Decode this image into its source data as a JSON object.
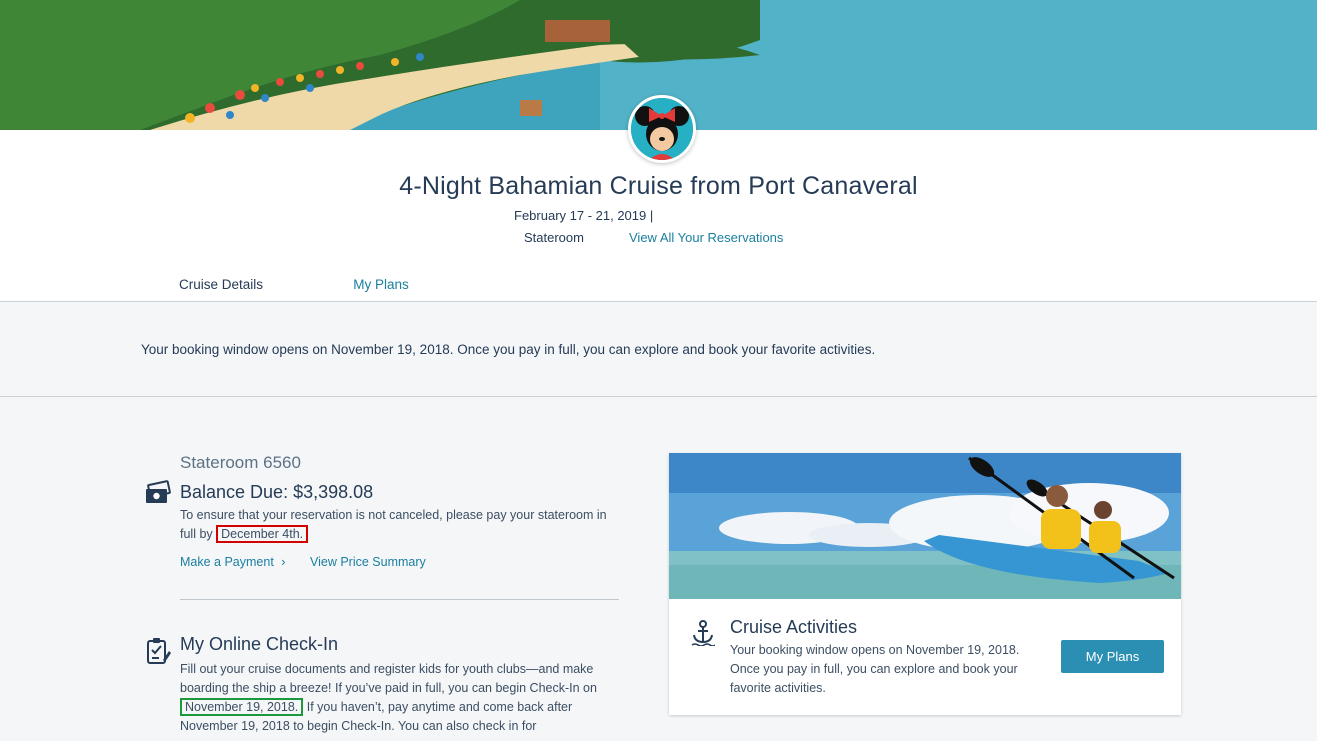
{
  "header": {
    "title": "4-Night Bahamian Cruise from Port Canaveral",
    "dates": "February 17 - 21, 2019 |",
    "stateroom_label": "Stateroom",
    "view_reservations_link": "View All Your Reservations"
  },
  "tabs": [
    {
      "label": "Cruise Details",
      "active": true
    },
    {
      "label": "My Plans",
      "active": false
    }
  ],
  "notice": "Your booking window opens on November 19, 2018. Once you pay in full, you can explore and book your favorite activities.",
  "stateroom_section": {
    "stateroom_number": "Stateroom 6560",
    "balance_due": "Balance Due: $3,398.08",
    "text_line1": "To ensure that your reservation is not canceled, please pay your stateroom in",
    "text_prefix": "full by",
    "due_date": "December 4th.",
    "make_payment_link": "Make a Payment",
    "view_price_link": "View Price Summary"
  },
  "checkin_section": {
    "title": "My Online Check-In",
    "line1": "Fill out your cruise documents and register kids for youth clubs—and make",
    "line2": "boarding the ship a breeze! If you’ve paid in full, you can begin Check-In on",
    "highlight_date": "November 19, 2018.",
    "line3_rest": " If you haven’t, pay anytime and come back after",
    "line4": "November 19, 2018 to begin Check-In. You can also check in for"
  },
  "activities_card": {
    "title": "Cruise Activities",
    "text": "Your booking window opens on November 19, 2018. Once you pay in full, you can explore and book your favorite activities.",
    "button_label": "My Plans"
  },
  "icons": {
    "avatar": "minnie-mouse-avatar",
    "balance": "cash-payment-icon",
    "checkin": "clipboard-check-icon",
    "activities": "anchor-icon"
  },
  "colors": {
    "accent": "#1b7fa0",
    "button": "#2a8fb2",
    "text": "#253b56",
    "highlight_red": "#d40000",
    "highlight_green": "#1a9a3c"
  }
}
